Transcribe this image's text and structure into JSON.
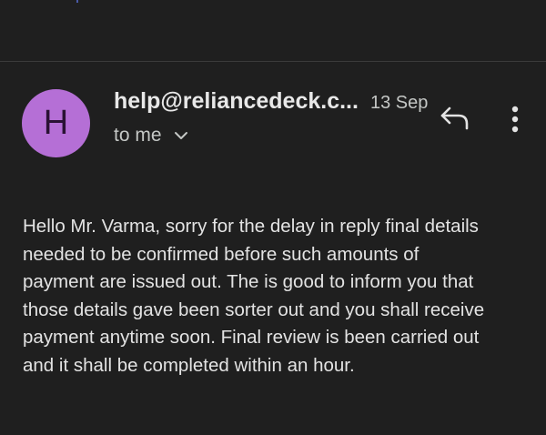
{
  "email": {
    "avatar_letter": "H",
    "sender": "help@reliancedeck.c...",
    "date": "13 Sep",
    "recipient_label": "to me",
    "body_lines": [
      "Hello Mr. Varma, sorry for the delay in reply final details",
      "needed to be confirmed before such amounts of",
      "payment are issued out. The is good to inform you that",
      "those details gave been sorter out and you shall receive",
      "payment anytime soon. Final review is been carried out",
      "and it shall be completed within an hour."
    ]
  },
  "icons": {
    "reply": "reply-icon",
    "more": "more-vert-icon",
    "chevron": "chevron-down-icon"
  },
  "colors": {
    "background": "#1f1f1f",
    "avatar": "#b56fd6",
    "text": "#e3e3e3",
    "secondary_text": "#c4c7c5"
  }
}
